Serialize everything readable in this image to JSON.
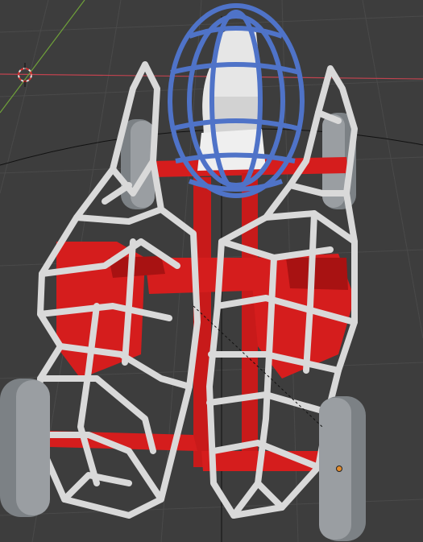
{
  "viewport": {
    "background": "#3d3d3d",
    "grid_color": "#4a4a4a",
    "axis_red": "#c0434f",
    "axis_green": "#6fa13a",
    "horizon_color": "#111111"
  },
  "scene": {
    "lattice_color": "#d9d9d9",
    "lattice_shadow": "#9a9a9a",
    "cage_color": "#4f73c8",
    "body_color": "#d51d1d",
    "body_dark": "#a81212",
    "wheel_color": "#8b8f93",
    "seat_color": "#e8e8e8",
    "origin_color": "#e38b2d"
  }
}
